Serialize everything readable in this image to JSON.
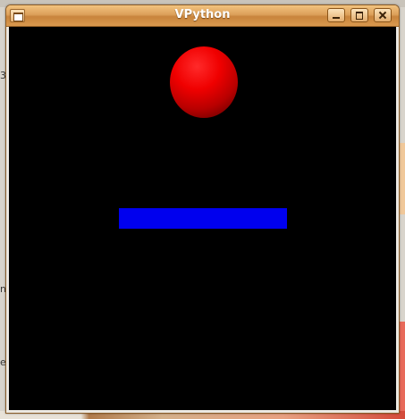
{
  "window": {
    "title": "VPython",
    "controls": {
      "menu_icon": "window-menu-icon",
      "minimize_icon": "minimize-icon",
      "maximize_icon": "maximize-icon",
      "close_icon": "close-icon"
    }
  },
  "scene": {
    "background_color": "#000000",
    "objects": [
      {
        "type": "sphere",
        "color": "#ff0000"
      },
      {
        "type": "box",
        "color": "#0000ee"
      }
    ]
  },
  "desktop": {
    "left_edge_chars": [
      "3",
      "n",
      "e"
    ]
  }
}
